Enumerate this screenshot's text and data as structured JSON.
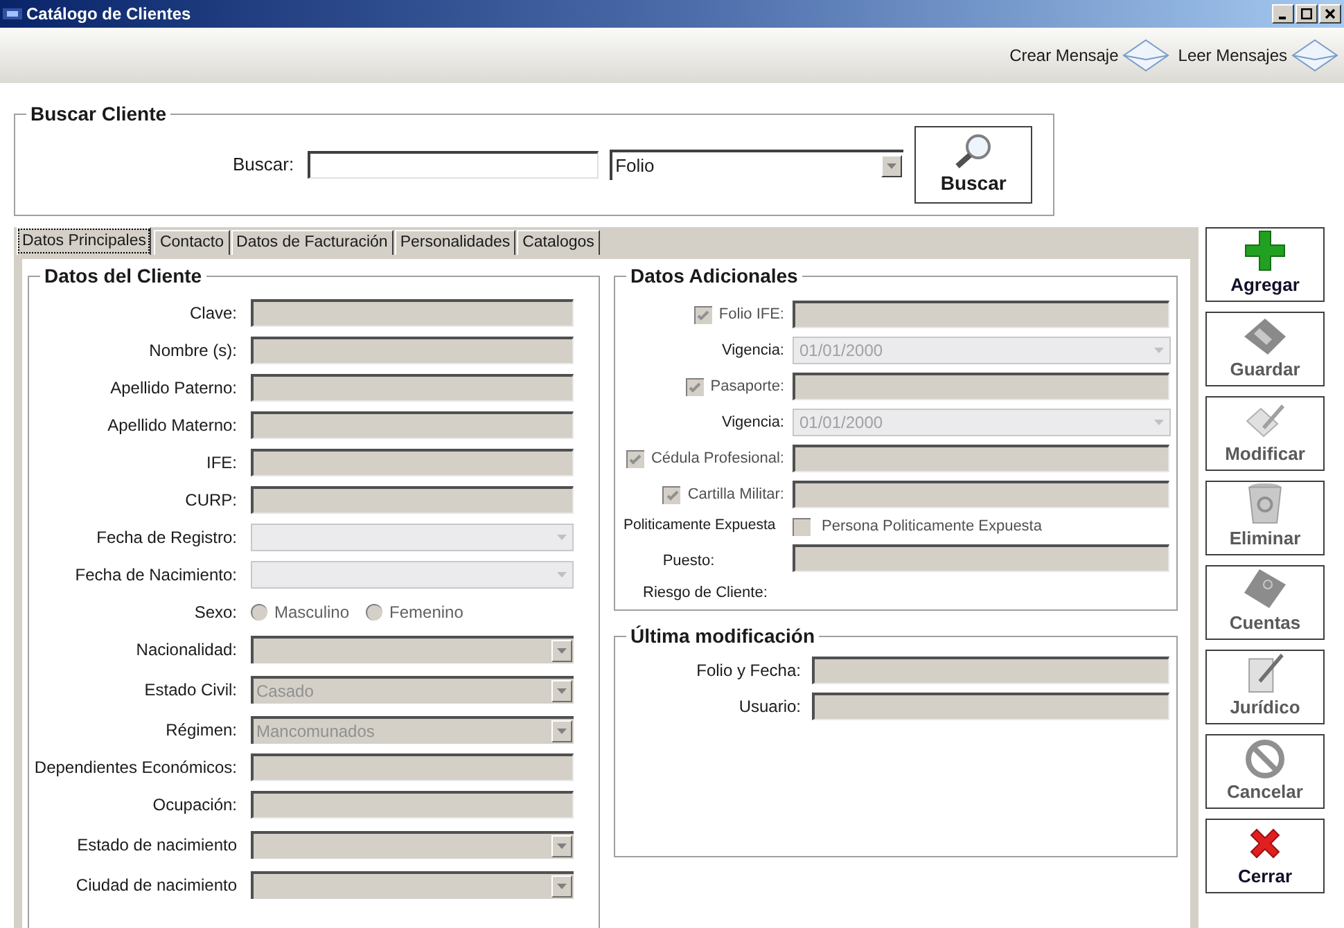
{
  "window": {
    "title": "Catálogo de Clientes"
  },
  "toolbar": [
    {
      "label": "Crear Mensaje"
    },
    {
      "label": "Leer Mensajes"
    }
  ],
  "search": {
    "title": "Buscar Cliente",
    "label": "Buscar:",
    "filter": {
      "value": "Folio"
    },
    "button": "Buscar"
  },
  "tabs": [
    {
      "label": "Datos Principales",
      "selected": true
    },
    {
      "label": "Contacto",
      "selected": false
    },
    {
      "label": "Datos de Facturación",
      "selected": false
    },
    {
      "label": "Personalidades",
      "selected": false
    },
    {
      "label": "Catalogos",
      "selected": false
    }
  ],
  "client": {
    "title": "Datos del Cliente",
    "rows": [
      {
        "kind": "text",
        "label": "Clave:"
      },
      {
        "kind": "text",
        "label": "Nombre (s):"
      },
      {
        "kind": "text",
        "label": "Apellido Paterno:"
      },
      {
        "kind": "text",
        "label": "Apellido Materno:"
      },
      {
        "kind": "text",
        "label": "IFE:"
      },
      {
        "kind": "text",
        "label": "CURP:"
      },
      {
        "kind": "date",
        "label": "Fecha de Registro:"
      },
      {
        "kind": "date",
        "label": "Fecha de Nacimiento:"
      },
      {
        "kind": "radio",
        "label": "Sexo:",
        "options": [
          {
            "label": "Masculino",
            "selected": false
          },
          {
            "label": "Femenino",
            "selected": false
          }
        ]
      },
      {
        "kind": "combo",
        "label": "Nacionalidad:"
      },
      {
        "kind": "combo",
        "label": "Estado Civil:",
        "value": "Casado"
      },
      {
        "kind": "combo",
        "label": "Régimen:",
        "value": "Mancomunados"
      },
      {
        "kind": "text",
        "label": "Dependientes Económicos:"
      },
      {
        "kind": "text",
        "label": "Ocupación:"
      },
      {
        "kind": "combo",
        "label": "Estado de nacimiento"
      },
      {
        "kind": "combo",
        "label": "Ciudad de nacimiento"
      }
    ]
  },
  "additional": {
    "title": "Datos Adicionales",
    "rows": [
      {
        "kind": "check_text",
        "label": "Folio IFE:",
        "checked": true
      },
      {
        "kind": "date",
        "label": "Vigencia:",
        "value": "01/01/2000"
      },
      {
        "kind": "check_text",
        "label": "Pasaporte:",
        "checked": true
      },
      {
        "kind": "date",
        "label": "Vigencia:",
        "value": "01/01/2000"
      },
      {
        "kind": "check_text",
        "label": "Cédula Profesional:",
        "checked": true
      },
      {
        "kind": "check_text",
        "label": "Cartilla Militar:",
        "checked": true
      },
      {
        "kind": "check",
        "label": "Politicamente Expuesta",
        "option": "Persona Politicamente Expuesta",
        "checked": false
      },
      {
        "kind": "text",
        "label": "Puesto:"
      },
      {
        "kind": "label",
        "label": "Riesgo de Cliente:"
      }
    ]
  },
  "last_modified": {
    "title": "Última modificación",
    "rows": [
      {
        "label": "Folio y Fecha:"
      },
      {
        "label": "Usuario:"
      }
    ]
  },
  "actions": [
    {
      "kind": "add",
      "label": "Agregar",
      "disabled": false
    },
    {
      "kind": "save",
      "label": "Guardar",
      "disabled": true
    },
    {
      "kind": "edit",
      "label": "Modificar",
      "disabled": true
    },
    {
      "kind": "delete",
      "label": "Eliminar",
      "disabled": true
    },
    {
      "kind": "accounts",
      "label": "Cuentas",
      "disabled": true
    },
    {
      "kind": "legal",
      "label": "Jurídico",
      "disabled": true
    },
    {
      "kind": "cancel",
      "label": "Cancelar",
      "disabled": true
    },
    {
      "kind": "close",
      "label": "Cerrar",
      "disabled": false
    }
  ]
}
